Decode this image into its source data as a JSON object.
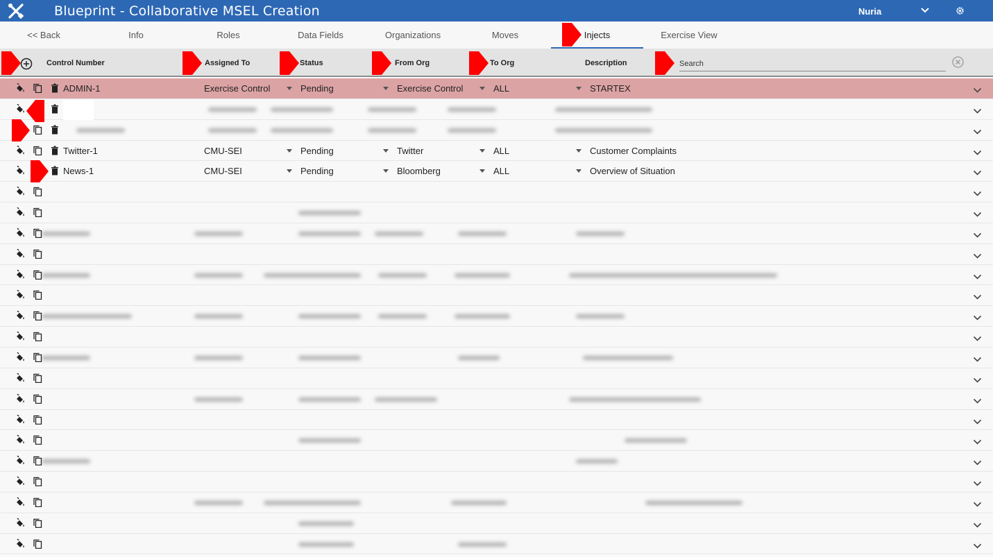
{
  "app": {
    "title": "Blueprint - Collaborative MSEL Creation",
    "user": "Nuria"
  },
  "tabs": [
    {
      "label": "<< Back"
    },
    {
      "label": "Info"
    },
    {
      "label": "Roles"
    },
    {
      "label": "Data Fields"
    },
    {
      "label": "Organizations"
    },
    {
      "label": "Moves"
    },
    {
      "label": "Injects"
    },
    {
      "label": "Exercise View"
    }
  ],
  "active_tab": "Injects",
  "columns": {
    "control_number": "Control Number",
    "assigned_to": "Assigned To",
    "status": "Status",
    "from_org": "From Org",
    "to_org": "To Org",
    "description": "Description"
  },
  "search": {
    "placeholder": "Search"
  },
  "rows": [
    {
      "control_number": "ADMIN-1",
      "assigned_to": "Exercise Control",
      "status": "Pending",
      "from_org": "Exercise Control",
      "to_org": "ALL",
      "description": "STARTEX",
      "highlight": true
    },
    {
      "control_number": "",
      "assigned_to": "",
      "status": "",
      "from_org": "",
      "to_org": "",
      "description": "",
      "obscured": true
    },
    {
      "control_number": "",
      "assigned_to": "",
      "status": "",
      "from_org": "",
      "to_org": "",
      "description": "",
      "obscured": true
    },
    {
      "control_number": "Twitter-1",
      "assigned_to": "CMU-SEI",
      "status": "Pending",
      "from_org": "Twitter",
      "to_org": "ALL",
      "description": "Customer Complaints"
    },
    {
      "control_number": "News-1",
      "assigned_to": "CMU-SEI",
      "status": "Pending",
      "from_org": "Bloomberg",
      "to_org": "ALL",
      "description": "Overview of Situation"
    }
  ],
  "blurred_row_count": 18,
  "colors": {
    "topbar": "#2d68b5",
    "highlight_row": "#dca3a5",
    "annotation_flag": "#ff0000",
    "header_bg": "#e3e3e3"
  },
  "icons": [
    "tools-logo-icon",
    "chevron-down-icon",
    "gear-icon",
    "add-circle-icon",
    "clear-search-icon",
    "paint-bucket-icon",
    "copy-icon",
    "trash-icon",
    "expand-chevron-icon"
  ]
}
